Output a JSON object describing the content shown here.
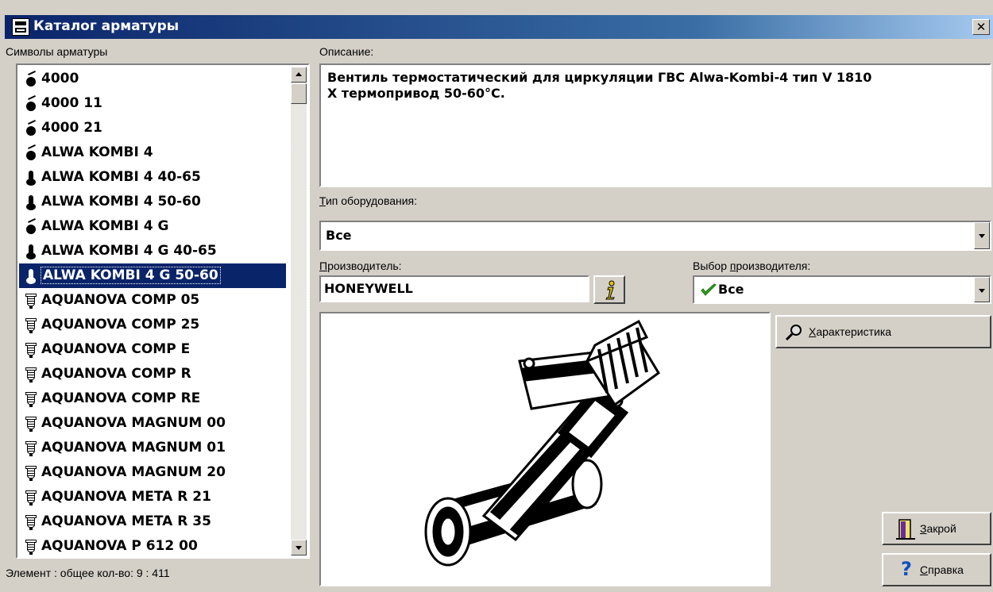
{
  "window": {
    "title": "Каталог арматуры",
    "close_glyph": "✕"
  },
  "list": {
    "label": "Символы арматуры",
    "items": [
      {
        "text": "4000",
        "icon": "valve-icon"
      },
      {
        "text": "4000 11",
        "icon": "valve-icon"
      },
      {
        "text": "4000 21",
        "icon": "valve-icon"
      },
      {
        "text": "ALWA KOMBI 4",
        "icon": "valve-icon"
      },
      {
        "text": "ALWA KOMBI 4 40-65",
        "icon": "thermostat-icon"
      },
      {
        "text": "ALWA KOMBI 4 50-60",
        "icon": "thermostat-icon"
      },
      {
        "text": "ALWA KOMBI 4 G",
        "icon": "valve-icon"
      },
      {
        "text": "ALWA KOMBI 4 G 40-65",
        "icon": "thermostat-icon"
      },
      {
        "text": "ALWA KOMBI 4 G 50-60",
        "icon": "thermostat-icon",
        "selected": true
      },
      {
        "text": "AQUANOVA COMP 05",
        "icon": "filter-icon"
      },
      {
        "text": "AQUANOVA COMP 25",
        "icon": "filter-icon"
      },
      {
        "text": "AQUANOVA COMP E",
        "icon": "filter-icon"
      },
      {
        "text": "AQUANOVA COMP R",
        "icon": "filter-icon"
      },
      {
        "text": "AQUANOVA COMP RE",
        "icon": "filter-icon"
      },
      {
        "text": "AQUANOVA MAGNUM 00",
        "icon": "filter-icon"
      },
      {
        "text": "AQUANOVA MAGNUM 01",
        "icon": "filter-icon"
      },
      {
        "text": "AQUANOVA MAGNUM 20",
        "icon": "filter-icon"
      },
      {
        "text": "AQUANOVA META R 21",
        "icon": "filter-icon"
      },
      {
        "text": "AQUANOVA META R 35",
        "icon": "filter-icon"
      },
      {
        "text": "AQUANOVA P 612 00",
        "icon": "filter-icon"
      }
    ]
  },
  "status": {
    "text": "Элемент : общее кол-во: 9 : 411"
  },
  "description": {
    "label": "Описание:",
    "text": "Вентиль термостатический для циркуляции ГВС Alwa-Kombi-4 тип V 1810\nX термопривод 50-60°С."
  },
  "equipment_type": {
    "label_first": "Т",
    "label_rest": "ип оборудования:",
    "value": "Все"
  },
  "manufacturer": {
    "label_first": "П",
    "label_rest": "роизводитель:",
    "value": "HONEYWELL"
  },
  "manufacturer_select": {
    "label_pre": "Выбор ",
    "label_u": "п",
    "label_post": "роизводителя:",
    "value": "Все"
  },
  "buttons": {
    "specs": {
      "u": "Х",
      "rest": "арактеристика"
    },
    "close": {
      "u": "З",
      "rest": "акрой"
    },
    "help": {
      "u": "С",
      "rest": "правка"
    }
  },
  "colors": {
    "title_bar": "#0a246a",
    "selection": "#0a246a",
    "face": "#d4d0c8",
    "check": "#2eaa1a",
    "help": "#1050c0"
  }
}
